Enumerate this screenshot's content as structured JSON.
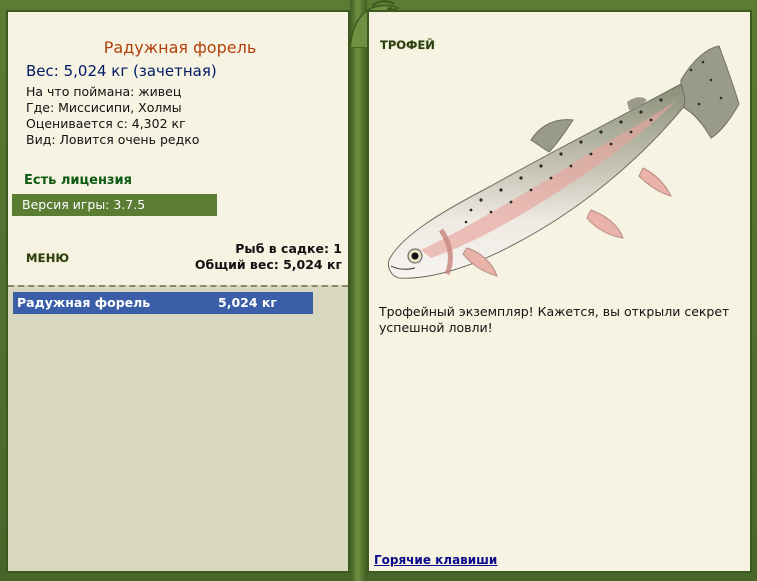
{
  "fish": {
    "name": "Радужная форель",
    "weight_line": "Вес: 5,024 кг (зачетная)",
    "caught_on": "На что поймана: живец",
    "where": "Где: Миссисипи, Холмы",
    "rated_from": "Оценивается с: 4,302 кг",
    "kind": "Вид: Ловится очень редко"
  },
  "license": "Есть лицензия",
  "version": "Версия игры: 3.7.5",
  "menu_label": "МЕНЮ",
  "keepnet": {
    "fish_count": "Рыб в садке: 1",
    "total_weight": "Общий вес: 5,024 кг"
  },
  "catch_list": [
    {
      "name": "Радужная форель",
      "weight": "5,024 кг"
    }
  ],
  "trophy": {
    "label": "ТРОФЕЙ",
    "message": "Трофейный экземпляр! Кажется, вы открыли секрет успешной ловли!"
  },
  "hotkeys_link": "Горячие клавиши",
  "colors": {
    "frame": "#5a7c33",
    "panel": "#f6f3e2",
    "fish_title": "#b2400c",
    "selection": "#3a5fa8"
  }
}
